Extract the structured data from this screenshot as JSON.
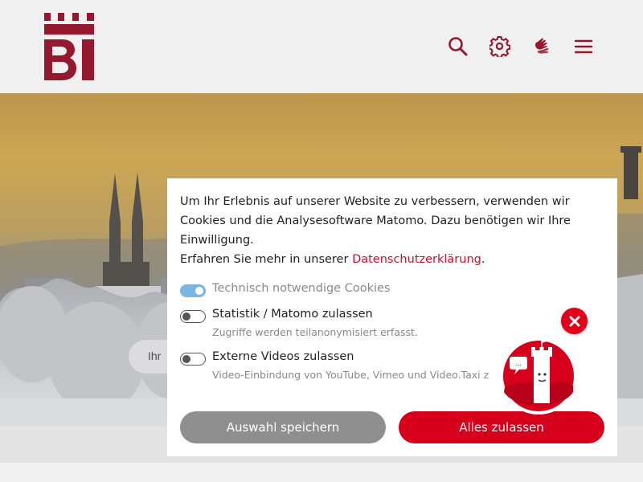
{
  "header": {
    "logo_text": "BI",
    "icons": {
      "search": "search-icon",
      "settings": "gear-icon",
      "sign_language": "sign-language-icon",
      "menu": "hamburger-menu-icon"
    },
    "accent_color": "#9e1b32"
  },
  "hero": {
    "search_text": "Ihr"
  },
  "cookie_dialog": {
    "intro_line1": "Um Ihr Erlebnis auf unserer Website zu verbessern, verwenden wir Cookies und die Analysesoftware Matomo. Dazu benötigen wir Ihre Einwilligung.",
    "intro_line2_prefix": "Erfahren Sie mehr in unserer ",
    "privacy_link": "Datenschutzerklärung",
    "intro_line2_suffix": ".",
    "options": [
      {
        "label": "Technisch notwendige Cookies",
        "enabled": true,
        "locked": true,
        "description": ""
      },
      {
        "label": "Statistik / Matomo zulassen",
        "enabled": false,
        "locked": false,
        "description": "Zugriffe werden teilanonymisiert erfasst."
      },
      {
        "label": "Externe Videos zulassen",
        "enabled": false,
        "locked": false,
        "description": "Video-Einbindung von YouTube, Vimeo und Video.Taxi z"
      }
    ],
    "save_button": "Auswahl speichern",
    "accept_all_button": "Alles zulassen",
    "colors": {
      "accept": "#d6001c",
      "save": "#8f8f8f",
      "link": "#c8102e",
      "toggle_on": "#79b6e6"
    }
  },
  "chatbot": {
    "close_icon": "close-icon",
    "avatar": "chatbot-tower-icon",
    "bubble_text": "..."
  }
}
